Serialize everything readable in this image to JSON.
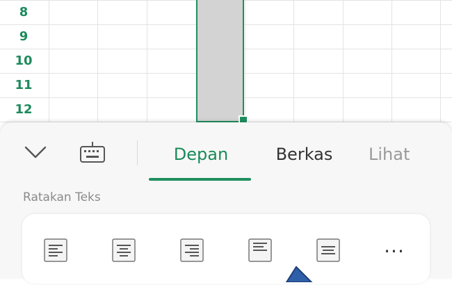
{
  "sheet": {
    "row_numbers": [
      "8",
      "9",
      "10",
      "11",
      "12"
    ]
  },
  "ribbon": {
    "tabs": [
      {
        "label": "Depan",
        "active": true
      },
      {
        "label": "Berkas",
        "active": false
      },
      {
        "label": "Lihat",
        "active": false
      }
    ],
    "section_label": "Ratakan Teks",
    "align_icons": [
      "align-left-icon",
      "align-center-icon",
      "align-right-icon",
      "align-top-icon",
      "align-middle-icon"
    ],
    "more_label": "···"
  },
  "icons": {
    "collapse": "chevron-down-icon",
    "keyboard": "keyboard-icon"
  },
  "colors": {
    "accent": "#1f8f5f",
    "row_number": "#1d8a5c",
    "selection_fill": "#d3d3d3"
  }
}
